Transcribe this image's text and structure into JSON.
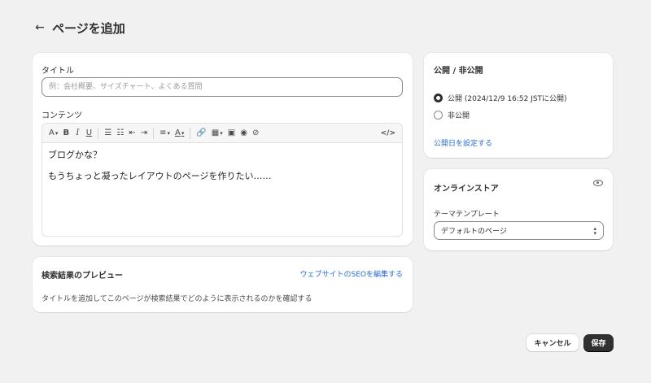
{
  "header": {
    "back_icon": "←",
    "title": "ページを追加"
  },
  "editor_card": {
    "title_label": "タイトル",
    "title_placeholder": "例：会社概要、サイズチャート、よくある質問",
    "content_label": "コンテンツ",
    "toolbar": {
      "text_format": "A",
      "bold": "B",
      "italic": "I",
      "underline": "U",
      "bullet_list": "☰",
      "numbered_list": "☷",
      "outdent": "⇤",
      "indent": "⇥",
      "align": "≡",
      "text_color": "A",
      "link": "🔗",
      "table": "▦",
      "image": "▣",
      "video": "◉",
      "clear": "⊘",
      "code": "</>"
    },
    "lines": [
      "ブログかな？",
      "もうちょっと凝ったレイアウトのページを作りたい……"
    ]
  },
  "seo_card": {
    "title": "検索結果のプレビュー",
    "edit_link": "ウェブサイトのSEOを編集する",
    "description": "タイトルを追加してこのページが検索結果でどのように表示されるのかを確認する"
  },
  "visibility_card": {
    "title": "公開 / 非公開",
    "option_public": "公開 (2024/12/9 16:52 JSTに公開)",
    "option_private": "非公開",
    "set_date_link": "公開日を設定する"
  },
  "store_card": {
    "title": "オンラインストア",
    "template_label": "テーマテンプレート",
    "template_value": "デフォルトのページ"
  },
  "footer": {
    "cancel_label": "キャンセル",
    "save_label": "保存"
  }
}
